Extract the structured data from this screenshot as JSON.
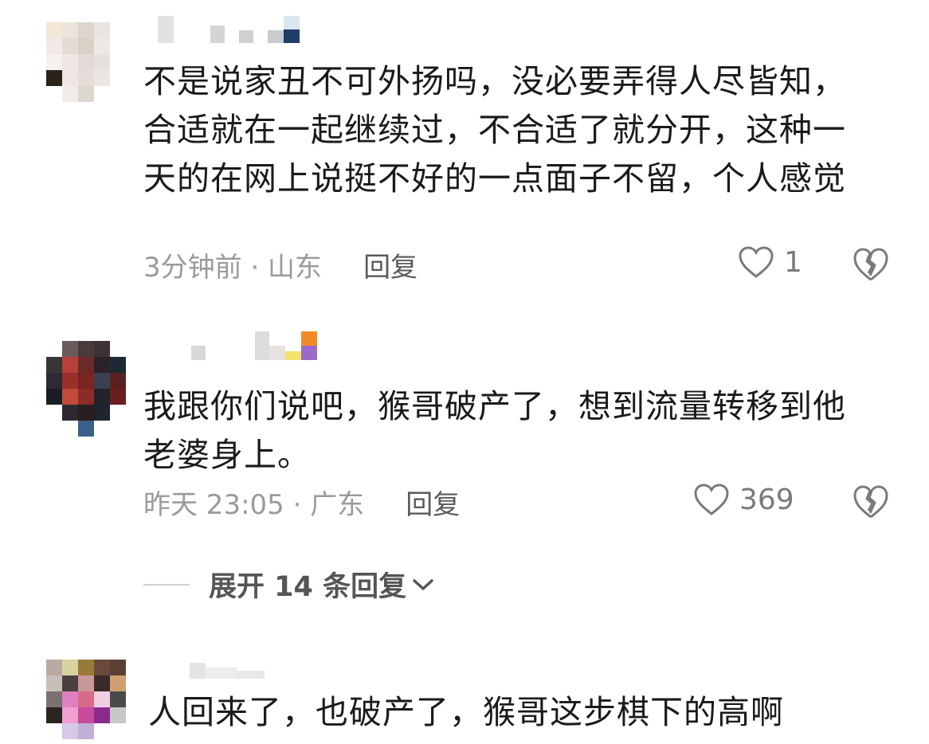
{
  "comments": [
    {
      "text": "不是说家丑不可外扬吗，没必要弄得人尽皆知，合适就在一起继续过，不合适了就分开，这种一天的在网上说挺不好的一点面子不留，个人感觉",
      "time_location": "3分钟前 · 山东",
      "reply_label": "回复",
      "likes": "1"
    },
    {
      "text": "我跟你们说吧，猴哥破产了，想到流量转移到他老婆身上。",
      "time_location": "昨天 23:05 · 广东",
      "reply_label": "回复",
      "likes": "369",
      "expand_label": "展开 14 条回复"
    },
    {
      "text": "人回来了，也破产了，猴哥这步棋下的高啊"
    }
  ],
  "colors": {
    "text": "#1a1a1a",
    "meta": "#9a9a9a",
    "reply": "#5a5a5a",
    "icon": "#7a7a7a"
  },
  "icons": [
    "heart-icon",
    "broken-heart-icon",
    "chevron-down-icon"
  ]
}
